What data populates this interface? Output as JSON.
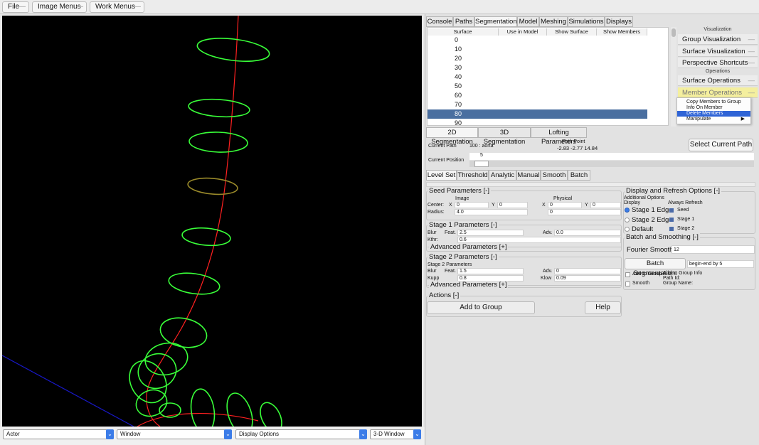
{
  "menubar": {
    "file": "File",
    "image_menus": "Image Menus",
    "work_menus": "Work Menus",
    "dash": "—"
  },
  "viewer_bar": {
    "actor": "Actor",
    "window": "Window",
    "display_options": "Display Options",
    "window_3d": "3-D Window",
    "arrow": "⌄"
  },
  "main_tabs": [
    "Console",
    "Paths",
    "Segmentation",
    "Model",
    "Meshing",
    "Simulations",
    "Displays"
  ],
  "table": {
    "headers": [
      "Surface",
      "Use in Model",
      "Show Surface",
      "Show Members"
    ],
    "rows": [
      "0",
      "10",
      "20",
      "30",
      "40",
      "50",
      "60",
      "70",
      "80",
      "90"
    ],
    "selected_row": "80"
  },
  "visualization": {
    "heading": "Visualization",
    "group_viz": "Group Visualization",
    "surface_viz": "Surface Visualization",
    "perspective": "Perspective Shortcuts",
    "ops_heading": "Operations",
    "surface_ops": "Surface Operations",
    "member_ops": "Member Operations",
    "dash": "—"
  },
  "context_menu": {
    "items": [
      "Copy Members to Group",
      "Info On Member",
      "Delete Members",
      "Manipulate"
    ],
    "highlighted": "Delete Members",
    "submenu_arrow": "▶"
  },
  "seg_tabs": [
    "2D Segmentation",
    "3D Segmentation",
    "Lofting Parameters"
  ],
  "path": {
    "current_path_label": "Current Path",
    "current_path_value": "100 : aorta",
    "path_point_label": "Path Point",
    "path_point_value": "-2.83  -2.77  14.84",
    "select_button": "Select Current Path",
    "current_position_label": "Current Position",
    "current_position_value": "5"
  },
  "method_tabs": [
    "Level Set",
    "Threshold",
    "Analytic",
    "Manual",
    "Smooth",
    "Batch"
  ],
  "seed": {
    "title": "Seed Parameters [-]",
    "image": "Image",
    "physical": "Physical",
    "center": "Center:",
    "radius": "Radius:",
    "x": "X",
    "y": "Y",
    "cx_img": "0",
    "cy_img": "0",
    "cx_phys": "0",
    "cy_phys": "0",
    "radius_img": "4.0",
    "radius_phys": "0"
  },
  "stage1": {
    "title": "Stage 1 Parameters [-]",
    "blur": "Blur",
    "feat": "Feat.",
    "feat_val": "2.5",
    "adv": "Adv.",
    "adv_val": "0.0",
    "kthr": "Kthr:",
    "kthr_val": "0.6",
    "advanced": "Advanced Parameters [+]"
  },
  "stage2": {
    "title": "Stage 2 Parameters [-]",
    "sub": "Stage 2 Parameters",
    "blur": "Blur",
    "feat": "Feat.",
    "feat_val": "1.5",
    "adv": "Adv.",
    "adv_val": "0",
    "kupp": "Kupp",
    "kupp_val": "0.8",
    "klow": "Klow",
    "klow_val": "0.09",
    "advanced": "Advanced Parameters [+]"
  },
  "actions": {
    "title": "Actions [-]",
    "add_group": "Add to Group",
    "help": "Help"
  },
  "display": {
    "title": "Display and Refresh Options [-]",
    "additional": "Additional Options",
    "display": "Display",
    "always_refresh": "Always Refresh",
    "stage1": "Stage 1 Edge",
    "stage2": "Stage 2 Edge",
    "default": "Default",
    "seed": "Seed",
    "stage1_r": "Stage 1",
    "stage2_r": "Stage 2"
  },
  "batch": {
    "title": "Batch and Smoothing [-]",
    "fourier": "Fourier Smooth:",
    "fourier_val": "12",
    "batch_seg": "Batch Segmentation:",
    "batch_val": "begin-end by 5",
    "add_to_group": "Add to Group",
    "add_group_info": "Add to Group Info",
    "path_id": "Path Id:",
    "smooth": "Smooth",
    "group_name": "Group Name:"
  },
  "colors": {
    "path_line": "#ff2020",
    "contour": "#39ff39",
    "selected_contour": "#9a8a2a",
    "axis": "#1818c8",
    "accent": "#2f64d6",
    "member_ops_bg": "#f4ef9e"
  }
}
